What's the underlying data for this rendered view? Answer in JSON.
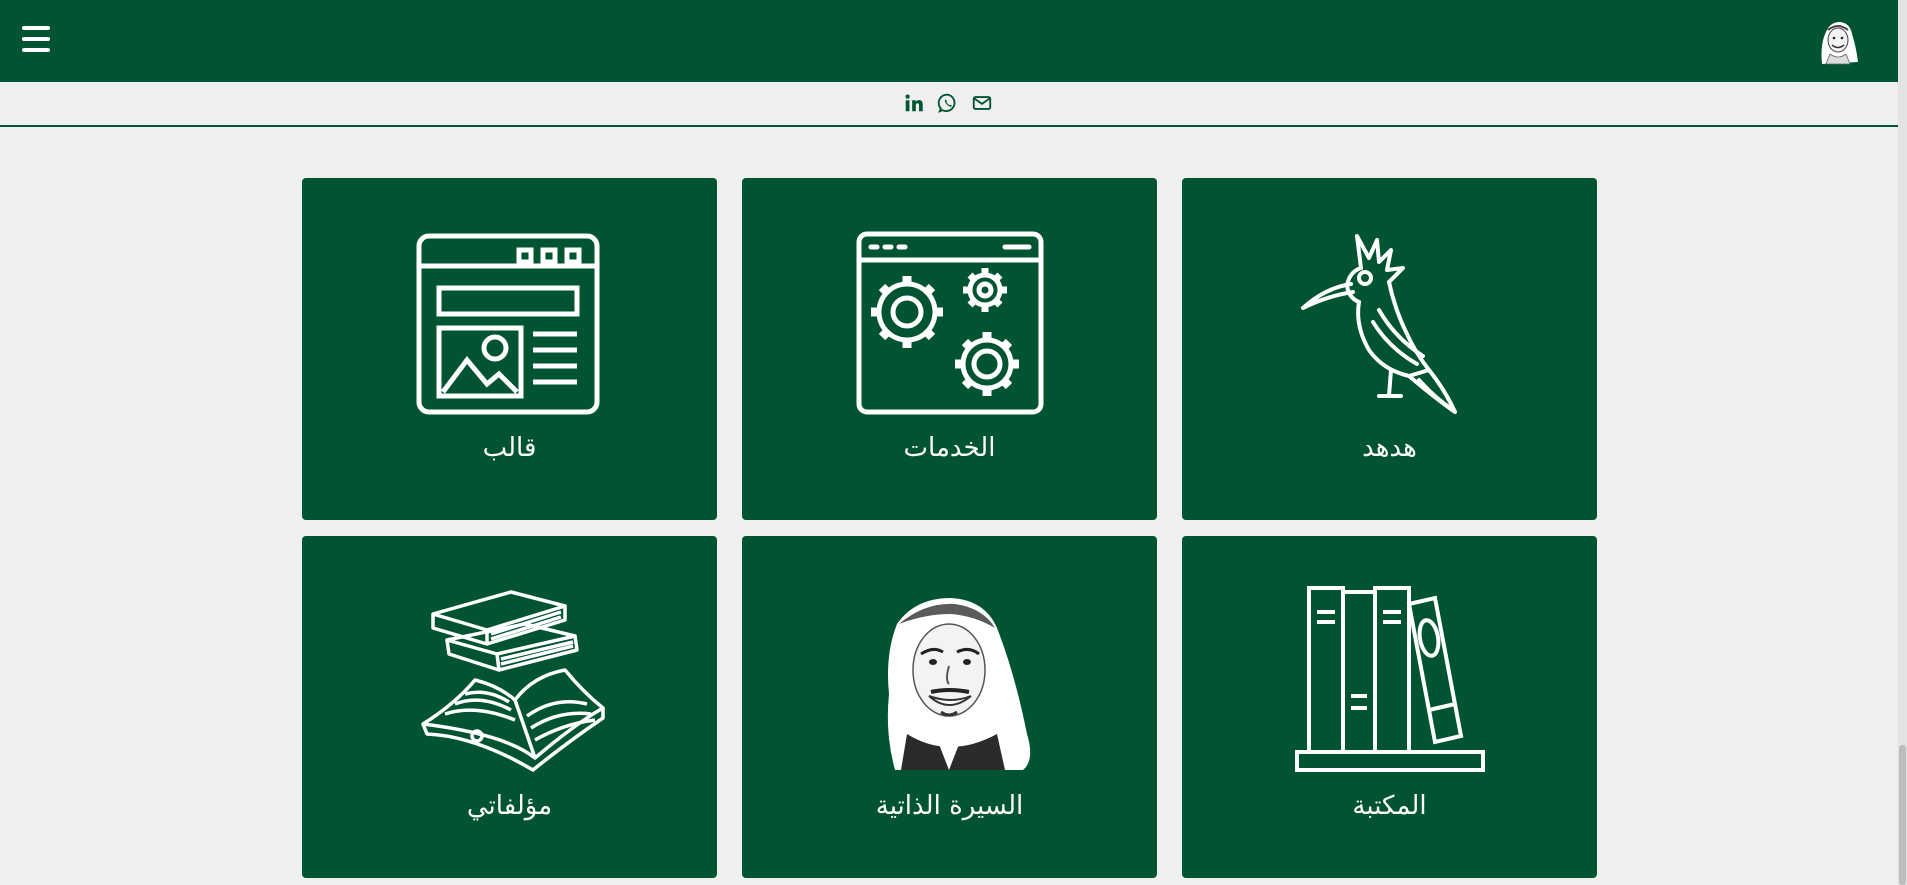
{
  "header": {
    "menu_icon": "hamburger-menu-icon",
    "avatar_icon": "profile-portrait-icon",
    "bg_color": "#005431"
  },
  "social": [
    {
      "name": "linkedin-icon"
    },
    {
      "name": "whatsapp-icon"
    },
    {
      "name": "email-icon"
    }
  ],
  "cards": [
    {
      "label": "قالب",
      "icon": "website-template-icon"
    },
    {
      "label": "الخدمات",
      "icon": "gears-window-icon"
    },
    {
      "label": "هدهد",
      "icon": "hoopoe-bird-icon"
    },
    {
      "label": "مؤلفاتي",
      "icon": "books-stack-icon"
    },
    {
      "label": "السيرة الذاتية",
      "icon": "portrait-icon"
    },
    {
      "label": "المكتبة",
      "icon": "bookshelf-icon"
    }
  ],
  "colors": {
    "brand": "#005431",
    "background": "#efefef",
    "text": "#ffffff"
  }
}
